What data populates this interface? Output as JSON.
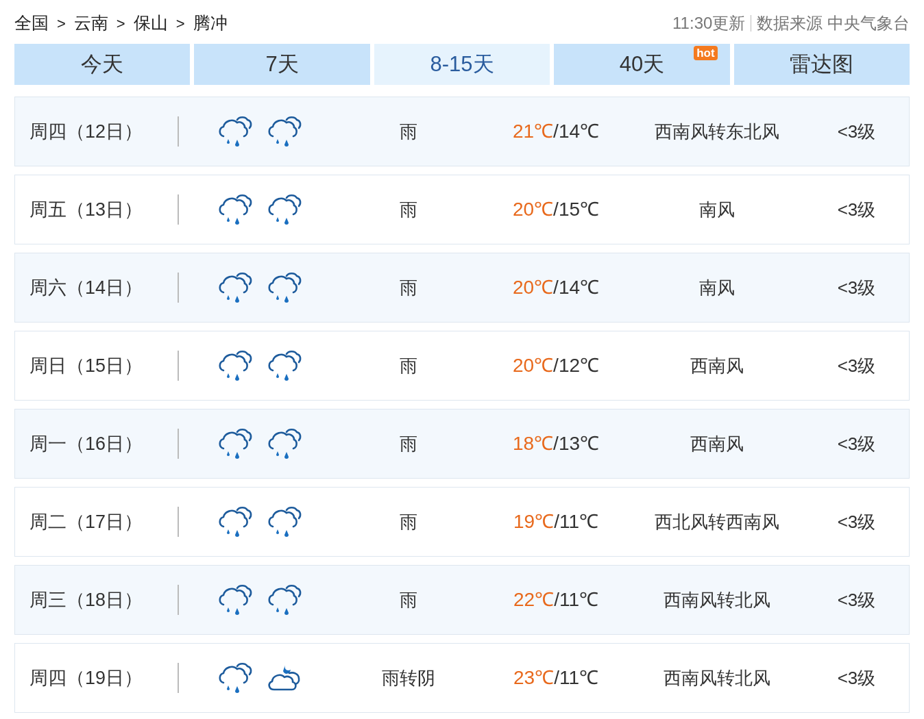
{
  "breadcrumb": [
    {
      "kind": "link",
      "text": "全国"
    },
    {
      "kind": "separator",
      "text": ">"
    },
    {
      "kind": "link",
      "text": "云南"
    },
    {
      "kind": "separator",
      "text": ">"
    },
    {
      "kind": "link",
      "text": "保山"
    },
    {
      "kind": "separator",
      "text": ">"
    },
    {
      "kind": "current",
      "text": "腾冲"
    }
  ],
  "update_time": "11:30更新",
  "source": "数据来源 中央气象台",
  "tabs": [
    {
      "label": "今天",
      "selected": false
    },
    {
      "label": "7天",
      "selected": false
    },
    {
      "label": "8-15天",
      "selected": true
    },
    {
      "label": "40天",
      "selected": false,
      "badge": "hot"
    },
    {
      "label": "雷达图",
      "selected": false
    }
  ],
  "days": [
    {
      "date": "周四（12日）",
      "icons": [
        {
          "kind": "rain"
        },
        {
          "kind": "rain"
        }
      ],
      "weather": "雨",
      "high": "21℃",
      "sep": "/",
      "low": "14℃",
      "wind": "西南风转东北风",
      "level": "<3级"
    },
    {
      "date": "周五（13日）",
      "icons": [
        {
          "kind": "rain"
        },
        {
          "kind": "rain"
        }
      ],
      "weather": "雨",
      "high": "20℃",
      "sep": "/",
      "low": "15℃",
      "wind": "南风",
      "level": "<3级"
    },
    {
      "date": "周六（14日）",
      "icons": [
        {
          "kind": "rain"
        },
        {
          "kind": "rain"
        }
      ],
      "weather": "雨",
      "high": "20℃",
      "sep": "/",
      "low": "14℃",
      "wind": "南风",
      "level": "<3级"
    },
    {
      "date": "周日（15日）",
      "icons": [
        {
          "kind": "rain"
        },
        {
          "kind": "rain"
        }
      ],
      "weather": "雨",
      "high": "20℃",
      "sep": "/",
      "low": "12℃",
      "wind": "西南风",
      "level": "<3级"
    },
    {
      "date": "周一（16日）",
      "icons": [
        {
          "kind": "rain"
        },
        {
          "kind": "rain"
        }
      ],
      "weather": "雨",
      "high": "18℃",
      "sep": "/",
      "low": "13℃",
      "wind": "西南风",
      "level": "<3级"
    },
    {
      "date": "周二（17日）",
      "icons": [
        {
          "kind": "rain"
        },
        {
          "kind": "rain"
        }
      ],
      "weather": "雨",
      "high": "19℃",
      "sep": "/",
      "low": "11℃",
      "wind": "西北风转西南风",
      "level": "<3级"
    },
    {
      "date": "周三（18日）",
      "icons": [
        {
          "kind": "rain"
        },
        {
          "kind": "rain"
        }
      ],
      "weather": "雨",
      "high": "22℃",
      "sep": "/",
      "low": "11℃",
      "wind": "西南风转北风",
      "level": "<3级"
    },
    {
      "date": "周四（19日）",
      "icons": [
        {
          "kind": "rain"
        },
        {
          "kind": "cloudy-night"
        }
      ],
      "weather": "雨转阴",
      "high": "23℃",
      "sep": "/",
      "low": "11℃",
      "wind": "西南风转北风",
      "level": "<3级"
    }
  ]
}
